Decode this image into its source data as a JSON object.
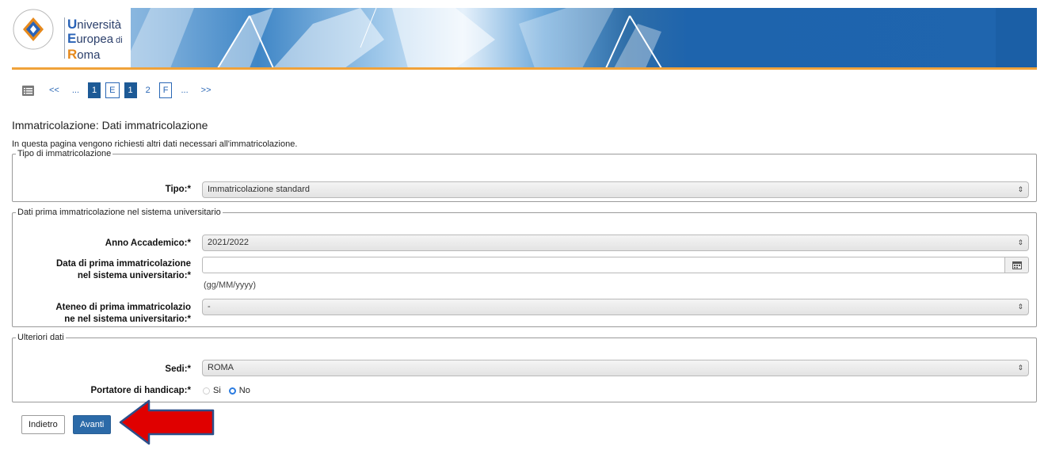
{
  "header": {
    "logo": {
      "line1_cap": "U",
      "line1_rest": "niversità",
      "line2_cap": "E",
      "line2_rest": "uropea",
      "line2_small": " di",
      "line3_cap": "R",
      "line3_rest": "oma"
    }
  },
  "pager": {
    "icon": "list-icon",
    "items": [
      "<<",
      "...",
      "1",
      "E",
      "1",
      "2",
      "F",
      "...",
      ">>"
    ]
  },
  "page": {
    "title": "Immatricolazione: Dati immatricolazione",
    "description": "In questa pagina vengono richiesti altri dati necessari all'immatricolazione."
  },
  "sections": {
    "tipo": {
      "legend": "Tipo di immatricolazione",
      "tipo_label": "Tipo:*",
      "tipo_value": "Immatricolazione standard"
    },
    "dati": {
      "legend": "Dati prima immatricolazione nel sistema universitario",
      "anno_label": "Anno Accademico:*",
      "anno_value": "2021/2022",
      "data_label_1": "Data di prima immatricolazione",
      "data_label_2": "nel sistema universitario:*",
      "data_value": "",
      "data_hint": "(gg/MM/yyyy)",
      "ateneo_label_1": "Ateneo di prima immatricolazio",
      "ateneo_label_2": "ne nel sistema universitario:*",
      "ateneo_value": "-"
    },
    "ulteriori": {
      "legend": "Ulteriori dati",
      "sedi_label": "Sedi:*",
      "sedi_value": "ROMA",
      "handicap_label": "Portatore di handicap:*",
      "opt_si": "Si",
      "opt_no": "No",
      "selected": "No"
    }
  },
  "buttons": {
    "back": "Indietro",
    "next": "Avanti"
  },
  "icons": {
    "select_arrow": "⇕",
    "calendar": "calendar-icon",
    "annotation": "red-arrow"
  },
  "colors": {
    "primary": "#2b6aa8",
    "accent": "#f0a23a",
    "annotation": "#e00000"
  }
}
